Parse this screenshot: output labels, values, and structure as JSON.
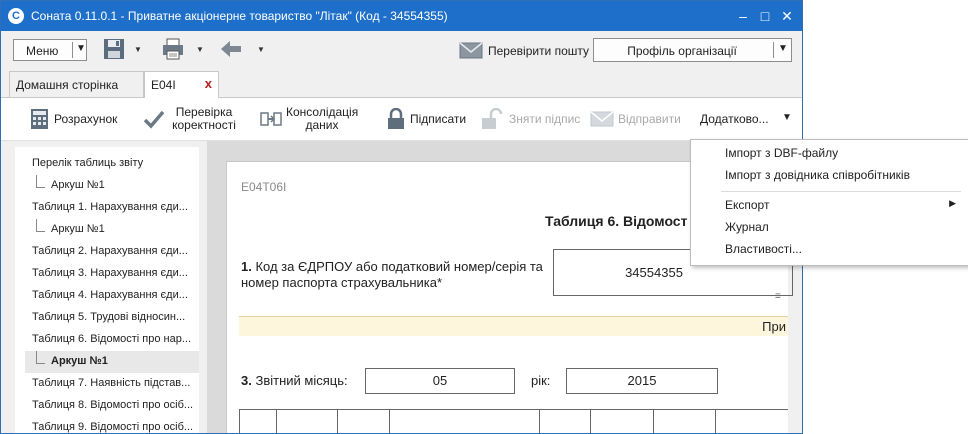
{
  "titlebar": {
    "app_logo": "С",
    "title": "Соната 0.11.0.1 - Приватне акціонерне товариство \"Літак\" (Код - 34554355)",
    "minimize": "–",
    "maximize": "□",
    "close": "✕"
  },
  "toolbar": {
    "menu_label": "Меню",
    "check_mail_label": "Перевірити пошту",
    "profile_label": "Профіль організації"
  },
  "tabs": [
    {
      "label": "Домашня сторінка"
    },
    {
      "label": "E04I",
      "close": "x"
    }
  ],
  "actions": {
    "calculate": "Розрахунок",
    "check_line1": "Перевірка",
    "check_line2": "коректності",
    "consolidate_line1": "Консолідація",
    "consolidate_line2": "даних",
    "sign": "Підписати",
    "unsign": "Зняти підпис",
    "send": "Відправити",
    "more": "Додатково..."
  },
  "sidebar": {
    "items": [
      {
        "label": "Перелік таблиць звіту"
      },
      {
        "label": "Аркуш №1"
      },
      {
        "label": "Таблиця 1. Нарахування єди..."
      },
      {
        "label": "Аркуш №1"
      },
      {
        "label": "Таблиця 2. Нарахування єди..."
      },
      {
        "label": "Таблиця 3. Нарахування єди..."
      },
      {
        "label": "Таблиця 4. Нарахування єди..."
      },
      {
        "label": "Таблиця 5. Трудові відносин..."
      },
      {
        "label": "Таблиця 6. Відомості про нар..."
      },
      {
        "label": "Аркуш №1"
      },
      {
        "label": "Таблиця 7. Наявність підстав..."
      },
      {
        "label": "Таблиця 8. Відомості про осіб..."
      },
      {
        "label": "Таблиця 9. Відомості про осіб..."
      }
    ]
  },
  "document": {
    "form_code": "E04T06I",
    "table_title": "Таблиця 6. Відомост",
    "field1_num": "1.",
    "field1_label": "Код за ЄДРПОУ або податковий номер/серія та номер паспорта страхувальника*",
    "field1_value": "34554355",
    "band_label": "При",
    "field3_num": "3.",
    "field3_label": "Звітний місяць:",
    "month_value": "05",
    "year_label": "рік:",
    "year_value": "2015"
  },
  "dropdown": {
    "import_dbf": "Імпорт з DBF-файлу",
    "import_employees": "Імпорт з довідника співробітників",
    "export": "Експорт",
    "journal": "Журнал",
    "properties": "Властивості..."
  },
  "colors": {
    "titlebar": "#1e6fc9",
    "tab_close": "#b81c1c",
    "band": "#fdf5dc"
  }
}
